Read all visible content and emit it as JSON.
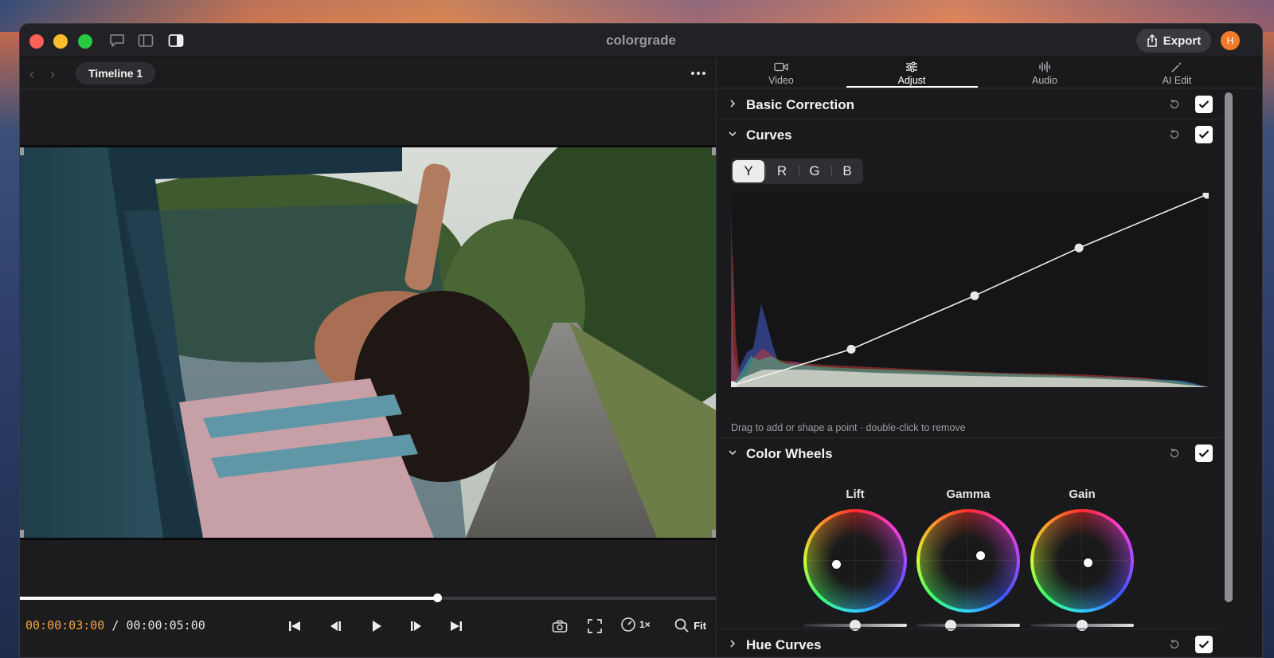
{
  "app": {
    "title": "colorgrade",
    "export_label": "Export",
    "avatar_initial": "H"
  },
  "viewer": {
    "timeline_label": "Timeline 1",
    "current_time": "00:00:03:00",
    "separator": "/",
    "duration": "00:00:05:00",
    "playhead_fraction": 0.6,
    "speed_label": "1×",
    "fit_label": "Fit"
  },
  "tabs": [
    {
      "label": "Video",
      "icon": "video-camera-icon"
    },
    {
      "label": "Adjust",
      "icon": "sliders-icon",
      "active": true
    },
    {
      "label": "Audio",
      "icon": "waveform-icon"
    },
    {
      "label": "AI Edit",
      "icon": "magic-wand-icon"
    }
  ],
  "sections": {
    "basic_correction": "Basic Correction",
    "curves": "Curves",
    "color_wheels": "Color Wheels",
    "hue_curves": "Hue Curves"
  },
  "curves": {
    "channels": [
      "Y",
      "R",
      "G",
      "B"
    ],
    "active_channel": "Y",
    "hint": "Drag to add or shape a point · double-click to remove",
    "points": [
      [
        0,
        0
      ],
      [
        0.25,
        0.19
      ],
      [
        0.51,
        0.47
      ],
      [
        0.73,
        0.72
      ],
      [
        1,
        1
      ]
    ]
  },
  "wheels": [
    {
      "label": "Lift",
      "dot": [
        -0.4,
        0.08
      ],
      "slider": 0.5
    },
    {
      "label": "Gamma",
      "dot": [
        0.27,
        -0.11
      ],
      "slider": 0.33
    },
    {
      "label": "Gain",
      "dot": [
        0.13,
        0.05
      ],
      "slider": 0.5
    }
  ]
}
